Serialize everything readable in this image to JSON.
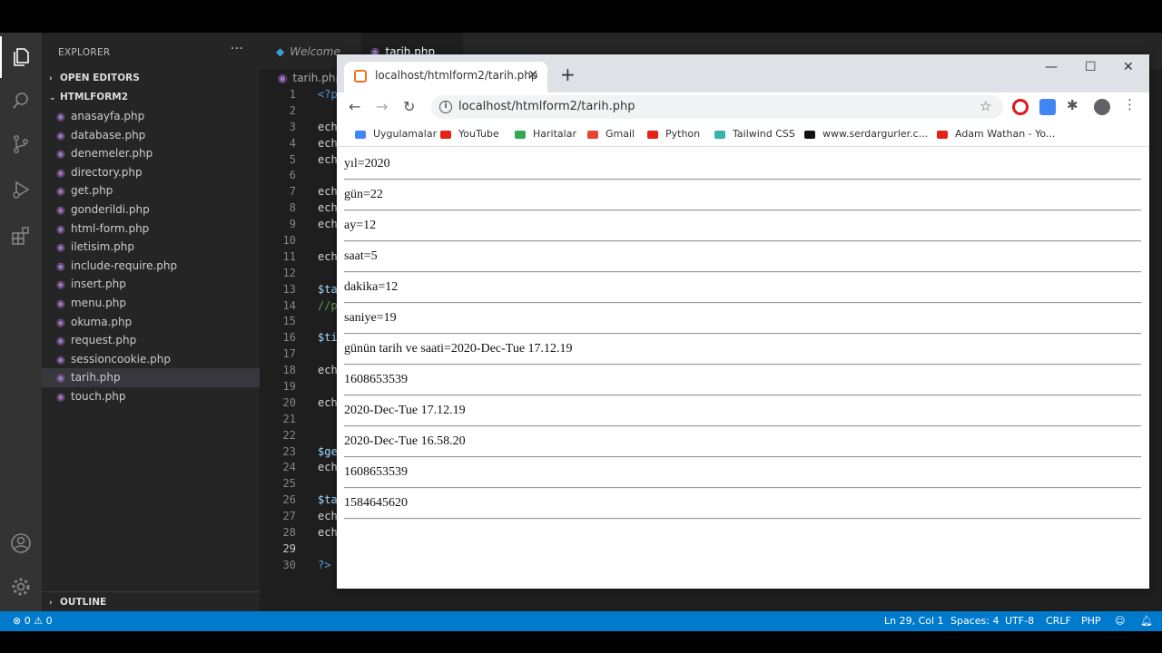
{
  "explorer": {
    "title": "EXPLORER",
    "more": "···",
    "open_editors": "OPEN EDITORS",
    "folder": "HTMLFORM2",
    "files": [
      "anasayfa.php",
      "database.php",
      "denemeler.php",
      "directory.php",
      "get.php",
      "gonderildi.php",
      "html-form.php",
      "iletisim.php",
      "include-require.php",
      "insert.php",
      "menu.php",
      "okuma.php",
      "request.php",
      "sessioncookie.php",
      "tarih.php",
      "touch.php"
    ],
    "selected_file": "tarih.php",
    "outline": "OUTLINE"
  },
  "editor": {
    "tabs": [
      {
        "label": "Welcome"
      },
      {
        "label": "tarih.php"
      }
    ],
    "breadcrumb": "tarih.php",
    "line_numbers": [
      "1",
      "2",
      "3",
      "4",
      "5",
      "6",
      "7",
      "8",
      "9",
      "10",
      "11",
      "12",
      "13",
      "14",
      "15",
      "16",
      "17",
      "18",
      "19",
      "20",
      "21",
      "22",
      "23",
      "24",
      "25",
      "26",
      "27",
      "28",
      "29",
      "30"
    ],
    "code_lines": [
      "<?p",
      "",
      "ech",
      "ech",
      "ech",
      "",
      "ech",
      "ech",
      "ech",
      "",
      "ech",
      "",
      "$ta",
      "//p",
      "",
      "$ti",
      "",
      "ech",
      "",
      "ech",
      "",
      "",
      "$ge",
      "ech",
      "",
      "$ta",
      "ech",
      "ech",
      "",
      "?>"
    ]
  },
  "status": {
    "errors": "⊗ 0 ⚠ 0",
    "position": "Ln 29, Col 1",
    "spaces": "Spaces: 4",
    "encoding": "UTF-8",
    "eol": "CRLF",
    "language": "PHP"
  },
  "browser": {
    "tab_title": "localhost/htmlform2/tarih.php",
    "url": "localhost/htmlform2/tarih.php",
    "bookmarks": [
      {
        "label": "Uygulamalar",
        "color": "#4285f4"
      },
      {
        "label": "YouTube",
        "color": "#e62117"
      },
      {
        "label": "Haritalar",
        "color": "#34a853"
      },
      {
        "label": "Gmail",
        "color": "#ea4335"
      },
      {
        "label": "Python",
        "color": "#e62117"
      },
      {
        "label": "Tailwind CSS",
        "color": "#38b2ac"
      },
      {
        "label": "www.serdargurler.c...",
        "color": "#111111"
      },
      {
        "label": "Adam Wathan - Yo...",
        "color": "#e62117"
      }
    ],
    "output_lines": [
      "yıl=2020",
      "gün=22",
      "ay=12",
      "saat=5",
      "dakika=12",
      "saniye=19",
      "günün tarih ve saati=2020-Dec-Tue 17.12.19",
      "1608653539",
      "2020-Dec-Tue 17.12.19",
      "2020-Dec-Tue 16.58.20",
      "1608653539",
      "1584645620"
    ]
  }
}
